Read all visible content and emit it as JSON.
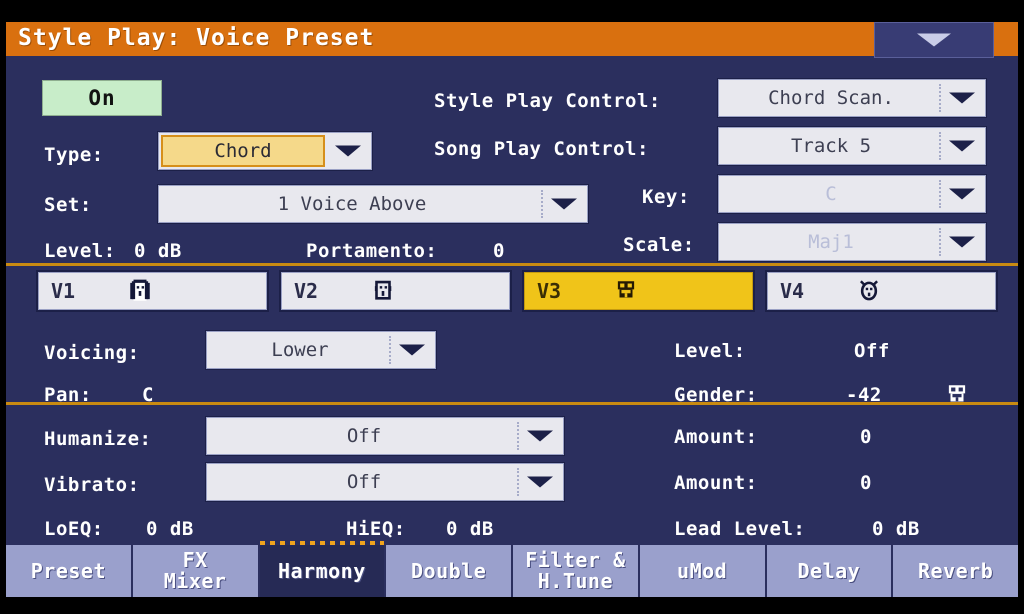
{
  "window": {
    "title": "Style Play: Voice Preset",
    "page_menu_icon": "chevron-down-icon"
  },
  "colors": {
    "title_bar": "#d9700f",
    "panel_bg": "#2b2f5e",
    "accent_rule": "#c98b12",
    "selected_tab": "#f0c419",
    "on_button": "#c8edc9",
    "highlight_field": "#f5d98a",
    "tab_bar": "#9aa0cc",
    "tab_active": "#262a55"
  },
  "top_section": {
    "on_button": "On",
    "type_label": "Type:",
    "type_value": "Chord",
    "set_label": "Set:",
    "set_value": "1 Voice Above",
    "level_label": "Level:",
    "level_value": "0 dB",
    "portamento_label": "Portamento:",
    "portamento_value": "0",
    "style_play_control_label": "Style Play Control:",
    "style_play_control_value": "Chord Scan.",
    "song_play_control_label": "Song Play Control:",
    "song_play_control_value": "Track 5",
    "key_label": "Key:",
    "key_value": "C",
    "scale_label": "Scale:",
    "scale_value": "Maj1"
  },
  "voice_tabs": [
    {
      "name": "V1",
      "icon": "face-hair-icon",
      "selected": false
    },
    {
      "name": "V2",
      "icon": "face-plain-icon",
      "selected": false
    },
    {
      "name": "V3",
      "icon": "face-beard-icon",
      "selected": true
    },
    {
      "name": "V4",
      "icon": "face-horns-icon",
      "selected": false
    }
  ],
  "voice_section": {
    "voicing_label": "Voicing:",
    "voicing_value": "Lower",
    "pan_label": "Pan:",
    "pan_value": "C",
    "level_label": "Level:",
    "level_value": "Off",
    "gender_label": "Gender:",
    "gender_value": "-42",
    "gender_icon": "face-beard-icon"
  },
  "effects_section": {
    "humanize_label": "Humanize:",
    "humanize_value": "Off",
    "humanize_amount_label": "Amount:",
    "humanize_amount_value": "0",
    "vibrato_label": "Vibrato:",
    "vibrato_value": "Off",
    "vibrato_amount_label": "Amount:",
    "vibrato_amount_value": "0",
    "loeq_label": "LoEQ:",
    "loeq_value": "0 dB",
    "hieq_label": "HiEQ:",
    "hieq_value": "0 dB",
    "lead_level_label": "Lead Level:",
    "lead_level_value": "0 dB"
  },
  "bottom_tabs": [
    {
      "line1": "Preset",
      "line2": "",
      "active": false
    },
    {
      "line1": "FX",
      "line2": "Mixer",
      "active": false
    },
    {
      "line1": "Harmony",
      "line2": "",
      "active": true
    },
    {
      "line1": "Double",
      "line2": "",
      "active": false
    },
    {
      "line1": "Filter &",
      "line2": "H.Tune",
      "active": false
    },
    {
      "line1": "uMod",
      "line2": "",
      "active": false
    },
    {
      "line1": "Delay",
      "line2": "",
      "active": false
    },
    {
      "line1": "Reverb",
      "line2": "",
      "active": false
    }
  ]
}
